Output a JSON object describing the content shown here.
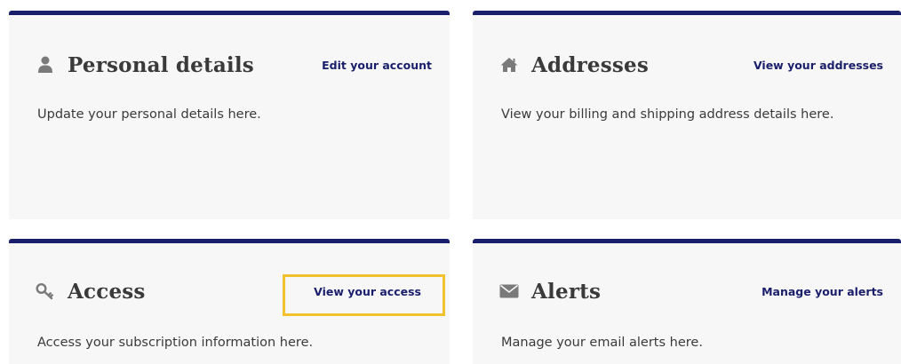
{
  "cards": [
    {
      "title": "Personal details",
      "link": "Edit your account",
      "description": "Update your personal details here.",
      "icon": "person-icon"
    },
    {
      "title": "Addresses",
      "link": "View your addresses",
      "description": "View your billing and shipping address details here.",
      "icon": "home-icon"
    },
    {
      "title": "Access",
      "link": "View your access",
      "description": "Access your subscription information here.",
      "icon": "key-icon",
      "highlighted": true
    },
    {
      "title": "Alerts",
      "link": "Manage your alerts",
      "description": "Manage your email alerts here.",
      "icon": "envelope-icon"
    }
  ],
  "colors": {
    "accent": "#1a1f6b",
    "card_bg": "#f7f7f8",
    "text": "#3a3a3a",
    "icon": "#7a7a7a",
    "highlight": "#f2c12e"
  }
}
